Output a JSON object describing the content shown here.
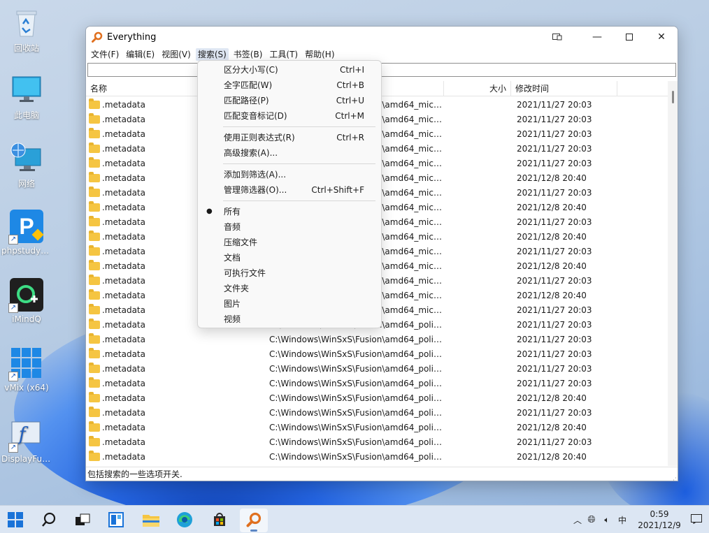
{
  "colors": {
    "menu_active_bg": "#dfe7f3",
    "folder": "#f5c542",
    "taskbar_bg": "#dce6f3",
    "window_bg": "#ffffff"
  },
  "desktop": {
    "icons": [
      {
        "label": "回收站",
        "icon": "recycle-bin-icon"
      },
      {
        "label": "此电脑",
        "icon": "computer-icon"
      },
      {
        "label": "网络",
        "icon": "network-icon"
      },
      {
        "label": "phpstudy_...",
        "icon": "phpstudy-icon"
      },
      {
        "label": "iMindQ",
        "icon": "imindq-icon"
      },
      {
        "label": "vMix (x64)",
        "icon": "vmix-icon"
      },
      {
        "label": "DisplayFus...",
        "icon": "displayfusion-icon"
      }
    ]
  },
  "window": {
    "title": "Everything",
    "menu": [
      "文件(F)",
      "编辑(E)",
      "视图(V)",
      "搜索(S)",
      "书签(B)",
      "工具(T)",
      "帮助(H)"
    ],
    "search": {
      "value": "",
      "placeholder": ""
    },
    "columns": {
      "name": "名称",
      "path": "",
      "size": "大小",
      "modified": "修改时间"
    },
    "rows": [
      {
        "name": ".metadata",
        "path": "C:\\Windows\\WinSxS\\Fusion\\amd64_micr...",
        "date": "2021/11/27 20:03"
      },
      {
        "name": ".metadata",
        "path": "C:\\Windows\\WinSxS\\Fusion\\amd64_micr...",
        "date": "2021/11/27 20:03"
      },
      {
        "name": ".metadata",
        "path": "C:\\Windows\\WinSxS\\Fusion\\amd64_micr...",
        "date": "2021/11/27 20:03"
      },
      {
        "name": ".metadata",
        "path": "C:\\Windows\\WinSxS\\Fusion\\amd64_micr...",
        "date": "2021/11/27 20:03"
      },
      {
        "name": ".metadata",
        "path": "C:\\Windows\\WinSxS\\Fusion\\amd64_micr...",
        "date": "2021/11/27 20:03"
      },
      {
        "name": ".metadata",
        "path": "C:\\Windows\\WinSxS\\Fusion\\amd64_micr...",
        "date": "2021/12/8 20:40"
      },
      {
        "name": ".metadata",
        "path": "C:\\Windows\\WinSxS\\Fusion\\amd64_micr...",
        "date": "2021/11/27 20:03"
      },
      {
        "name": ".metadata",
        "path": "C:\\Windows\\WinSxS\\Fusion\\amd64_micr...",
        "date": "2021/12/8 20:40"
      },
      {
        "name": ".metadata",
        "path": "C:\\Windows\\WinSxS\\Fusion\\amd64_micr...",
        "date": "2021/11/27 20:03"
      },
      {
        "name": ".metadata",
        "path": "C:\\Windows\\WinSxS\\Fusion\\amd64_micr...",
        "date": "2021/12/8 20:40"
      },
      {
        "name": ".metadata",
        "path": "C:\\Windows\\WinSxS\\Fusion\\amd64_micr...",
        "date": "2021/11/27 20:03"
      },
      {
        "name": ".metadata",
        "path": "C:\\Windows\\WinSxS\\Fusion\\amd64_micr...",
        "date": "2021/12/8 20:40"
      },
      {
        "name": ".metadata",
        "path": "C:\\Windows\\WinSxS\\Fusion\\amd64_micr...",
        "date": "2021/11/27 20:03"
      },
      {
        "name": ".metadata",
        "path": "C:\\Windows\\WinSxS\\Fusion\\amd64_micr...",
        "date": "2021/12/8 20:40"
      },
      {
        "name": ".metadata",
        "path": "C:\\Windows\\WinSxS\\Fusion\\amd64_micr...",
        "date": "2021/11/27 20:03"
      },
      {
        "name": ".metadata",
        "path": "C:\\Windows\\WinSxS\\Fusion\\amd64_polic...",
        "date": "2021/11/27 20:03"
      },
      {
        "name": ".metadata",
        "path": "C:\\Windows\\WinSxS\\Fusion\\amd64_polic...",
        "date": "2021/11/27 20:03"
      },
      {
        "name": ".metadata",
        "path": "C:\\Windows\\WinSxS\\Fusion\\amd64_polic...",
        "date": "2021/11/27 20:03"
      },
      {
        "name": ".metadata",
        "path": "C:\\Windows\\WinSxS\\Fusion\\amd64_polic...",
        "date": "2021/11/27 20:03"
      },
      {
        "name": ".metadata",
        "path": "C:\\Windows\\WinSxS\\Fusion\\amd64_polic...",
        "date": "2021/11/27 20:03"
      },
      {
        "name": ".metadata",
        "path": "C:\\Windows\\WinSxS\\Fusion\\amd64_polic...",
        "date": "2021/12/8 20:40"
      },
      {
        "name": ".metadata",
        "path": "C:\\Windows\\WinSxS\\Fusion\\amd64_polic...",
        "date": "2021/11/27 20:03"
      },
      {
        "name": ".metadata",
        "path": "C:\\Windows\\WinSxS\\Fusion\\amd64_polic...",
        "date": "2021/12/8 20:40"
      },
      {
        "name": ".metadata",
        "path": "C:\\Windows\\WinSxS\\Fusion\\amd64_polic...",
        "date": "2021/11/27 20:03"
      },
      {
        "name": ".metadata",
        "path": "C:\\Windows\\WinSxS\\Fusion\\amd64_polic...",
        "date": "2021/12/8 20:40"
      }
    ],
    "status": "包括搜索的一些选项开关."
  },
  "search_menu": {
    "groups": [
      [
        {
          "label": "区分大小写(C)",
          "shortcut": "Ctrl+I"
        },
        {
          "label": "全字匹配(W)",
          "shortcut": "Ctrl+B"
        },
        {
          "label": "匹配路径(P)",
          "shortcut": "Ctrl+U"
        },
        {
          "label": "匹配变音标记(D)",
          "shortcut": "Ctrl+M"
        }
      ],
      [
        {
          "label": "使用正则表达式(R)",
          "shortcut": "Ctrl+R"
        },
        {
          "label": "高级搜索(A)...",
          "shortcut": ""
        }
      ],
      [
        {
          "label": "添加到筛选(A)...",
          "shortcut": ""
        },
        {
          "label": "管理筛选器(O)...",
          "shortcut": "Ctrl+Shift+F"
        }
      ],
      [
        {
          "label": "所有",
          "shortcut": "",
          "checked": true
        },
        {
          "label": "音频",
          "shortcut": ""
        },
        {
          "label": "压缩文件",
          "shortcut": ""
        },
        {
          "label": "文档",
          "shortcut": ""
        },
        {
          "label": "可执行文件",
          "shortcut": ""
        },
        {
          "label": "文件夹",
          "shortcut": ""
        },
        {
          "label": "图片",
          "shortcut": ""
        },
        {
          "label": "视频",
          "shortcut": ""
        }
      ]
    ]
  },
  "taskbar": {
    "apps": [
      "start-icon",
      "search-icon",
      "task-view-icon",
      "widgets-icon",
      "file-explorer-icon",
      "edge-icon",
      "store-icon",
      "everything-icon"
    ],
    "tray": {
      "ime": "中",
      "time": "0:59",
      "date": "2021/12/9"
    }
  }
}
